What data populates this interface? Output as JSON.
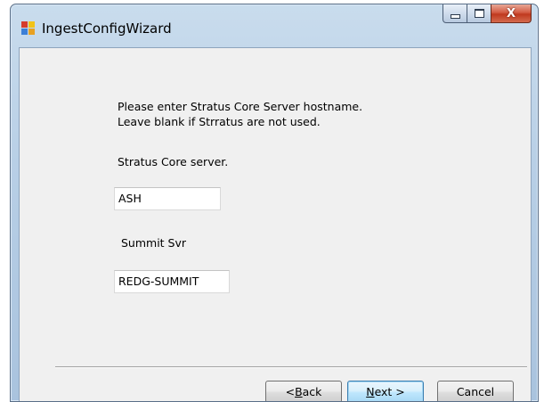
{
  "window": {
    "title": "IngestConfigWizard",
    "icon": "app-window-icon",
    "close_glyph": "X"
  },
  "content": {
    "instruction_line1": "Please enter Stratus Core Server hostname.",
    "instruction_line2": "Leave blank if Strratus are not used.",
    "core_server_label": "Stratus Core server.",
    "core_server_value": "ASH",
    "summit_label": "Summit Svr",
    "summit_value": "REDG-SUMMIT"
  },
  "buttons": {
    "back_prefix": "< ",
    "back_hotkey": "B",
    "back_rest": "ack",
    "next_hotkey": "N",
    "next_rest": "ext >",
    "cancel": "Cancel"
  },
  "colors": {
    "titlebar": "#b8cfe6",
    "client": "#f0f0f0",
    "close_button": "#c0391e",
    "default_button_border": "#3c7fb1"
  }
}
